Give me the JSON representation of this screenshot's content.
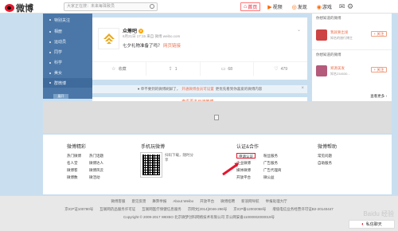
{
  "topbar": {
    "logo_text": "微博",
    "search_placeholder": "大家正在搜：未来每珠致员",
    "nav": [
      {
        "label": "首页",
        "glyph": "⌂",
        "active": true
      },
      {
        "label": "视频",
        "glyph": "▶",
        "active": false
      },
      {
        "label": "发现",
        "glyph": "◎",
        "active": false
      },
      {
        "label": "游戏",
        "glyph": "◉",
        "active": false
      }
    ],
    "user_label": "",
    "settings_glyph": "✉ ⚙"
  },
  "sidebar": {
    "items": [
      "特别关注",
      "相册",
      "运动员",
      "同学",
      "科学",
      "美女",
      "群微博"
    ],
    "foot": "展开"
  },
  "card": {
    "name": "众筹吧",
    "verified_glyph": "V",
    "meta": "6月21日 17:15 来自 微博 weibo.com",
    "text": "七夕礼物准备了吗？",
    "link_text": "网页链接",
    "chev_glyph": "⌄",
    "actions": [
      {
        "glyph": "☆",
        "label": "收藏"
      },
      {
        "glyph": "⇪",
        "label": "1"
      },
      {
        "glyph": "▭",
        "label": "68"
      },
      {
        "glyph": "♡",
        "label": "479"
      }
    ]
  },
  "notice": {
    "text1": "● 单不要到的微博刷屏了，",
    "link": "开通微博会员可设置",
    "text2": "更优先看到你喜爱的微博内容",
    "close": "×"
  },
  "more_bar": "查看更多已读微博 ⌄",
  "right": {
    "title1": "你想知道的微博",
    "user1": {
      "name": "我就要出发",
      "sub": "知名的旅行博主",
      "follow": "+ 关注"
    },
    "title2": "你想知道的微博",
    "user2": {
      "name": "郑源美发",
      "sub": "知名234530...",
      "follow": "+ 关注"
    },
    "more": "查看更多 ›"
  },
  "ad": {
    "icon": "doc-icon"
  },
  "footer": {
    "col1": {
      "title": "微博精彩",
      "links_a": [
        "热门微博",
        "名人堂",
        "微博客",
        "微博数"
      ],
      "links_b": [
        "热门话题",
        "微博达人",
        "微博风云",
        "微活动"
      ]
    },
    "col2": {
      "title": "手机玩微博",
      "qr_text": "扫码下载，随时分享"
    },
    "col3": {
      "title": "认证&合作",
      "links_a": [
        "申请认证",
        "企业微博",
        "媒体微博",
        "开放平台"
      ],
      "links_b": [
        "粉丝服务",
        "广告服务",
        "广告代理商",
        "微公益"
      ]
    },
    "col4": {
      "title": "微博帮助",
      "links": [
        "常见问题",
        "自助服务"
      ]
    }
  },
  "bottom": {
    "row1": [
      "微博客服",
      "意见反馈",
      "舞弊举报",
      "About Weibo",
      "开放平台",
      "微博招聘",
      "新浪网导航",
      "举报处理大厅"
    ],
    "row2": [
      "京ICP证100780号",
      "互联网药品服务许可证",
      "互联网医疗保健信息服务",
      "京网文[2014]2046-296号",
      "京ICP备12002058号",
      "增值电信业务经营许可证B2-20140447"
    ],
    "row3": "Copyright © 2009-2017 WEIBO 北京微梦创科网络技术有限公司   京公网安备11000002000019号",
    "privacy": "私信聊天",
    "watermark": "Baidu 经验"
  }
}
